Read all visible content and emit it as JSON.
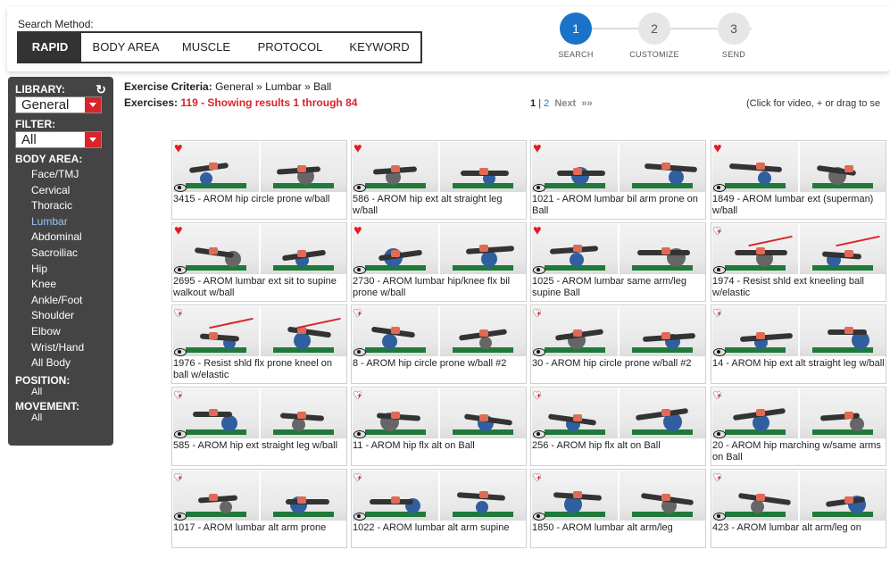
{
  "search_method": {
    "label": "Search Method:",
    "tabs": [
      "RAPID",
      "BODY AREA",
      "MUSCLE",
      "PROTOCOL",
      "KEYWORD"
    ],
    "active": "RAPID"
  },
  "steps": [
    {
      "num": "1",
      "label": "SEARCH"
    },
    {
      "num": "2",
      "label": "CUSTOMIZE"
    },
    {
      "num": "3",
      "label": "SEND"
    }
  ],
  "sidebar": {
    "library_label": "LIBRARY:",
    "library_value": "General",
    "filter_label": "FILTER:",
    "filter_value": "All",
    "body_area_label": "BODY AREA:",
    "body_areas": [
      "Face/TMJ",
      "Cervical",
      "Thoracic",
      "Lumbar",
      "Abdominal",
      "Sacroiliac",
      "Hip",
      "Knee",
      "Ankle/Foot",
      "Shoulder",
      "Elbow",
      "Wrist/Hand",
      "All Body"
    ],
    "active_area": "Lumbar",
    "position_label": "POSITION:",
    "position_value": "All",
    "movement_label": "MOVEMENT:",
    "movement_value": "All"
  },
  "criteria": {
    "label": "Exercise Criteria:",
    "value": "General » Lumbar » Ball",
    "exercises_label": "Exercises:",
    "exercises_value": "119 - Showing results 1 through 84"
  },
  "pager": {
    "current": "1",
    "sep": "|",
    "page2": "2",
    "next": "Next",
    "next_icon": "»»"
  },
  "hint": "(Click for video, + or drag to se",
  "exercises": [
    {
      "caption": "3415 - AROM hip circle prone w/ball",
      "fav": true
    },
    {
      "caption": "586 - AROM hip ext alt straight leg w/ball",
      "fav": true
    },
    {
      "caption": "1021 - AROM lumbar bil arm prone on Ball",
      "fav": true
    },
    {
      "caption": "1849 - AROM lumbar ext (superman) w/ball",
      "fav": true
    },
    {
      "caption": "2695 - AROM lumbar ext sit to supine walkout w/ball",
      "fav": true
    },
    {
      "caption": "2730 - AROM lumbar hip/knee flx bil prone w/ball",
      "fav": true
    },
    {
      "caption": "1025 - AROM lumbar same arm/leg supine Ball",
      "fav": true
    },
    {
      "caption": "1974 - Resist shld ext kneeling ball w/elastic",
      "fav": false
    },
    {
      "caption": "1976 - Resist shld flx prone kneel on ball w/elastic",
      "fav": false
    },
    {
      "caption": "8 - AROM hip circle prone w/ball #2",
      "fav": false
    },
    {
      "caption": "30 - AROM hip circle prone w/ball #2",
      "fav": false
    },
    {
      "caption": "14 - AROM hip ext alt straight leg w/ball",
      "fav": false
    },
    {
      "caption": "585 - AROM hip ext straight leg w/ball",
      "fav": false
    },
    {
      "caption": "11 - AROM hip flx alt on Ball",
      "fav": false
    },
    {
      "caption": "256 - AROM hip flx alt on Ball",
      "fav": false
    },
    {
      "caption": "20 - AROM hip marching w/same arms on Ball",
      "fav": false
    },
    {
      "caption": "1017 - AROM lumbar alt arm prone",
      "fav": false
    },
    {
      "caption": "1022 - AROM lumbar alt arm supine",
      "fav": false
    },
    {
      "caption": "1850 - AROM lumbar alt arm/leg",
      "fav": false
    },
    {
      "caption": "423 - AROM lumbar alt arm/leg on",
      "fav": false
    }
  ]
}
